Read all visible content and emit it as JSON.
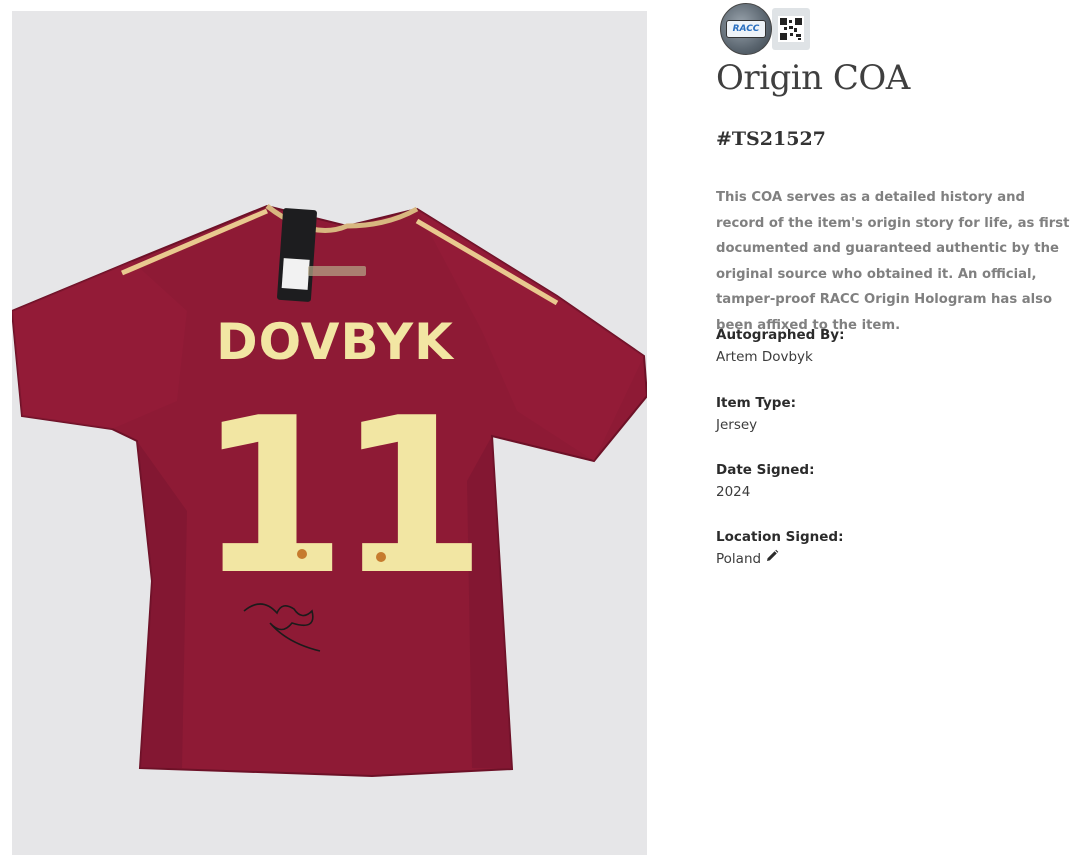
{
  "product_image": {
    "name_print": "DOVBYK",
    "number_print": "11"
  },
  "badge": {
    "hologram_text": "RACC",
    "qr_icon": "qr-code-icon"
  },
  "coa": {
    "title": "Origin COA",
    "id": "#TS21527",
    "description": "This COA serves as a detailed history and record of the item's origin story for life, as first documented and guaranteed authentic by the original source who obtained it. An official, tamper-proof RACC Origin Hologram has also been affixed to the item."
  },
  "fields": {
    "autographed_by": {
      "label": "Autographed By:",
      "value": "Artem Dovbyk"
    },
    "item_type": {
      "label": "Item Type:",
      "value": "Jersey"
    },
    "date_signed": {
      "label": "Date Signed:",
      "value": "2024"
    },
    "location_signed": {
      "label": "Location Signed:",
      "value": "Poland",
      "edit_icon": "pencil-icon"
    }
  },
  "colors": {
    "jersey": "#8e1a35",
    "print": "#f2e6a3",
    "background": "#e6e6e8"
  }
}
